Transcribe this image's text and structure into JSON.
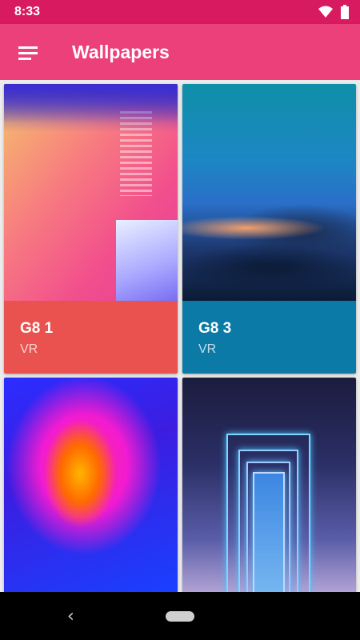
{
  "status_bar": {
    "time": "8:33",
    "icons": [
      "wifi-icon",
      "battery-icon"
    ]
  },
  "app_bar": {
    "title": "Wallpapers",
    "menu_icon": "hamburger-menu-icon",
    "background": "#ec407a"
  },
  "wallpapers": [
    {
      "title": "G8 1",
      "category": "VR",
      "accent": "#e9524e"
    },
    {
      "title": "G8 3",
      "category": "VR",
      "accent": "#0b7aa6"
    },
    {
      "title": "",
      "category": "",
      "accent": ""
    },
    {
      "title": "",
      "category": "",
      "accent": ""
    }
  ],
  "nav_bar": {
    "back_icon": "back-icon",
    "home_icon": "home-pill-icon"
  }
}
